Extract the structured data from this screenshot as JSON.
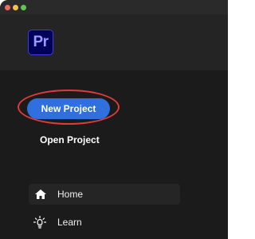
{
  "app": {
    "logo_text": "Pr"
  },
  "actions": {
    "new_project_label": "New Project",
    "open_project_label": "Open Project"
  },
  "nav": {
    "items": [
      {
        "label": "Home",
        "icon": "home-icon",
        "active": true
      },
      {
        "label": "Learn",
        "icon": "lightbulb-icon",
        "active": false
      }
    ]
  },
  "colors": {
    "accent": "#2f6fde",
    "highlight": "#e03a3a",
    "logo_bg": "#00005b",
    "logo_text": "#9999ff"
  }
}
